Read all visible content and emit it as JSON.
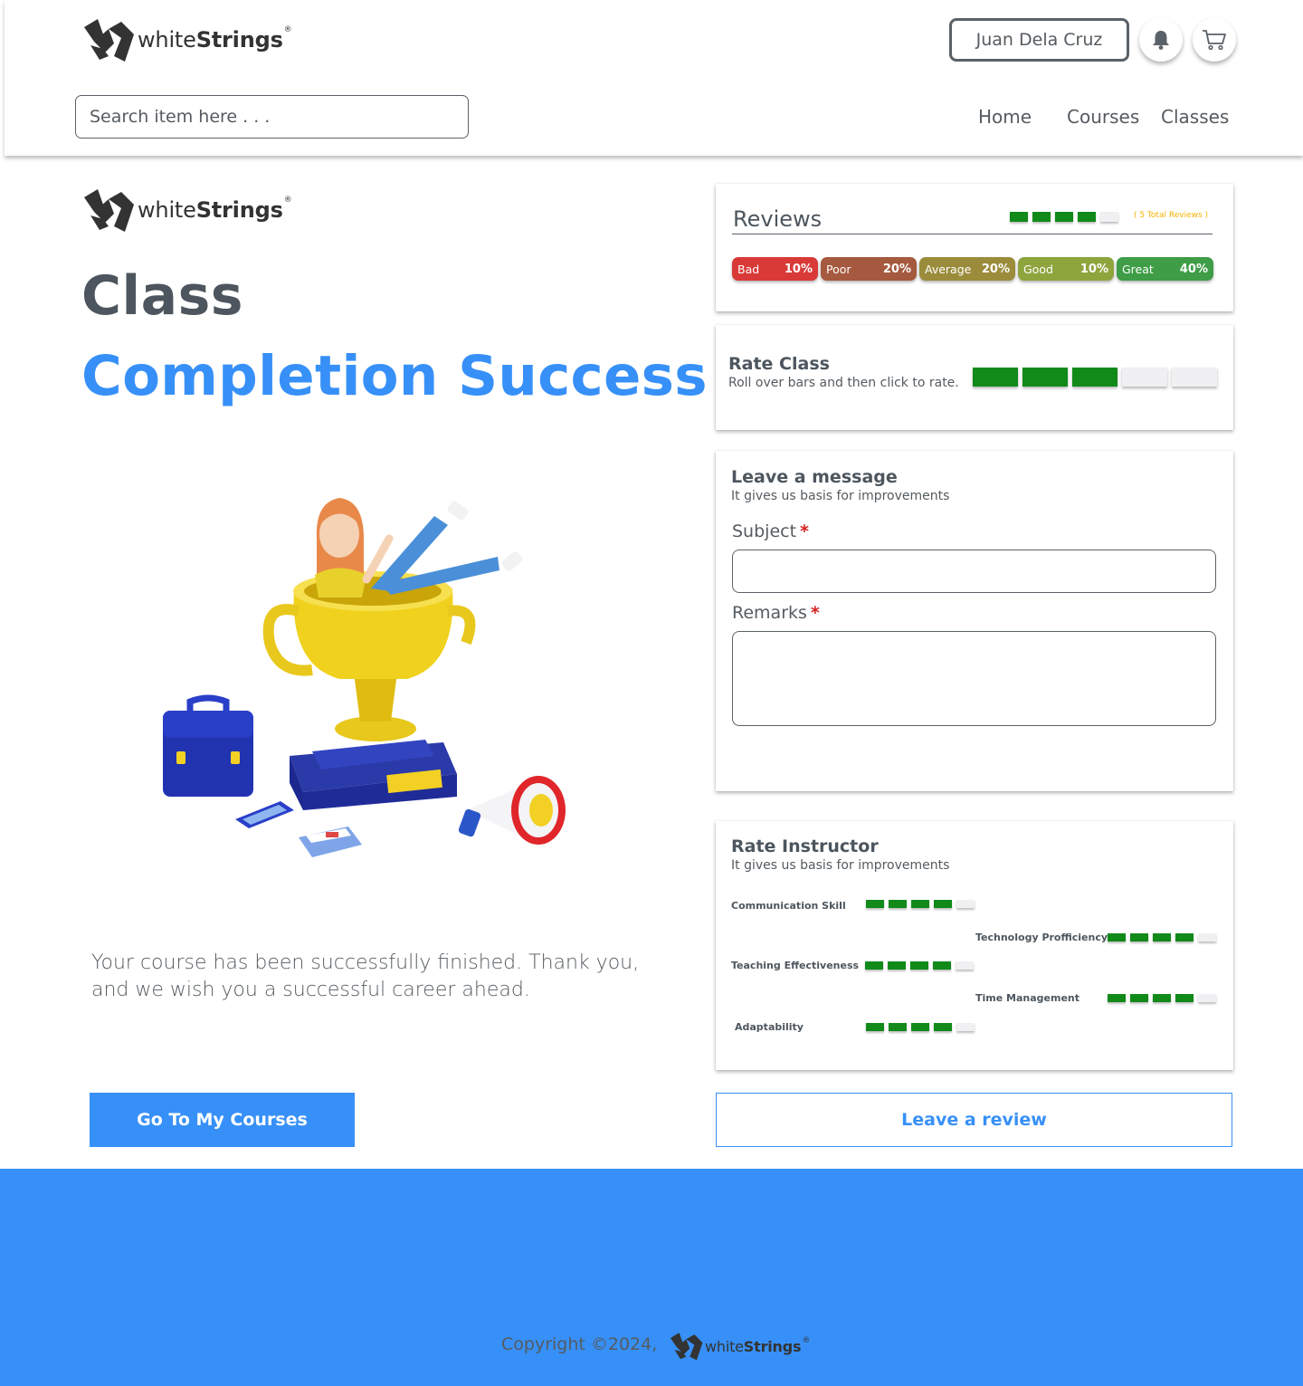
{
  "brand": {
    "name_light": "white",
    "name_bold": "Strings",
    "registered": "®"
  },
  "header": {
    "user_name": "Juan Dela Cruz",
    "bell_icon": "bell-icon",
    "cart_icon": "cart-icon",
    "search_placeholder": "Search item here . . .",
    "nav": [
      {
        "label": "Home"
      },
      {
        "label": "Courses"
      },
      {
        "label": "Classes"
      }
    ]
  },
  "hero": {
    "title_line1": "Class",
    "title_line2": "Completion Success",
    "message": "Your course has been successfully finished. Thank you, and we wish you a successful career ahead.",
    "primary_button": "Go To My Courses"
  },
  "reviews": {
    "title": "Reviews",
    "total_label": "( 5 Total Reviews )",
    "average_rating": 4,
    "max_rating": 5,
    "breakdown": [
      {
        "label": "Bad",
        "percent": "10%",
        "color": "#d93a37"
      },
      {
        "label": "Poor",
        "percent": "20%",
        "color": "#a5593e"
      },
      {
        "label": "Average",
        "percent": "20%",
        "color": "#9b8c3c"
      },
      {
        "label": "Good",
        "percent": "10%",
        "color": "#8ea43d"
      },
      {
        "label": "Great",
        "percent": "40%",
        "color": "#3e9d46"
      }
    ]
  },
  "rate_class": {
    "title": "Rate Class",
    "subtitle": "Roll over bars and then click to rate.",
    "rating": 3,
    "max_rating": 5
  },
  "message_form": {
    "title": "Leave a message",
    "subtitle": "It gives us basis for improvements",
    "subject_label": "Subject",
    "remarks_label": "Remarks",
    "required_mark": "*",
    "subject_value": "",
    "remarks_value": ""
  },
  "rate_instructor": {
    "title": "Rate Instructor",
    "subtitle": "It gives us basis for improvements",
    "skills": [
      {
        "label": "Communication Skill",
        "rating": 4
      },
      {
        "label": "Technology Profficiency",
        "rating": 4
      },
      {
        "label": "Teaching Effectiveness",
        "rating": 4
      },
      {
        "label": "Time Management",
        "rating": 4
      },
      {
        "label": "Adaptability",
        "rating": 4
      }
    ],
    "max_rating": 5
  },
  "review_button": "Leave a review",
  "footer": {
    "copyright": "Copyright ©2024,"
  },
  "colors": {
    "accent": "#3790f8",
    "rating_on": "#118a1a",
    "rating_off": "#f0f0f2",
    "total_reviews": "#f5b400",
    "required": "#d42020"
  }
}
